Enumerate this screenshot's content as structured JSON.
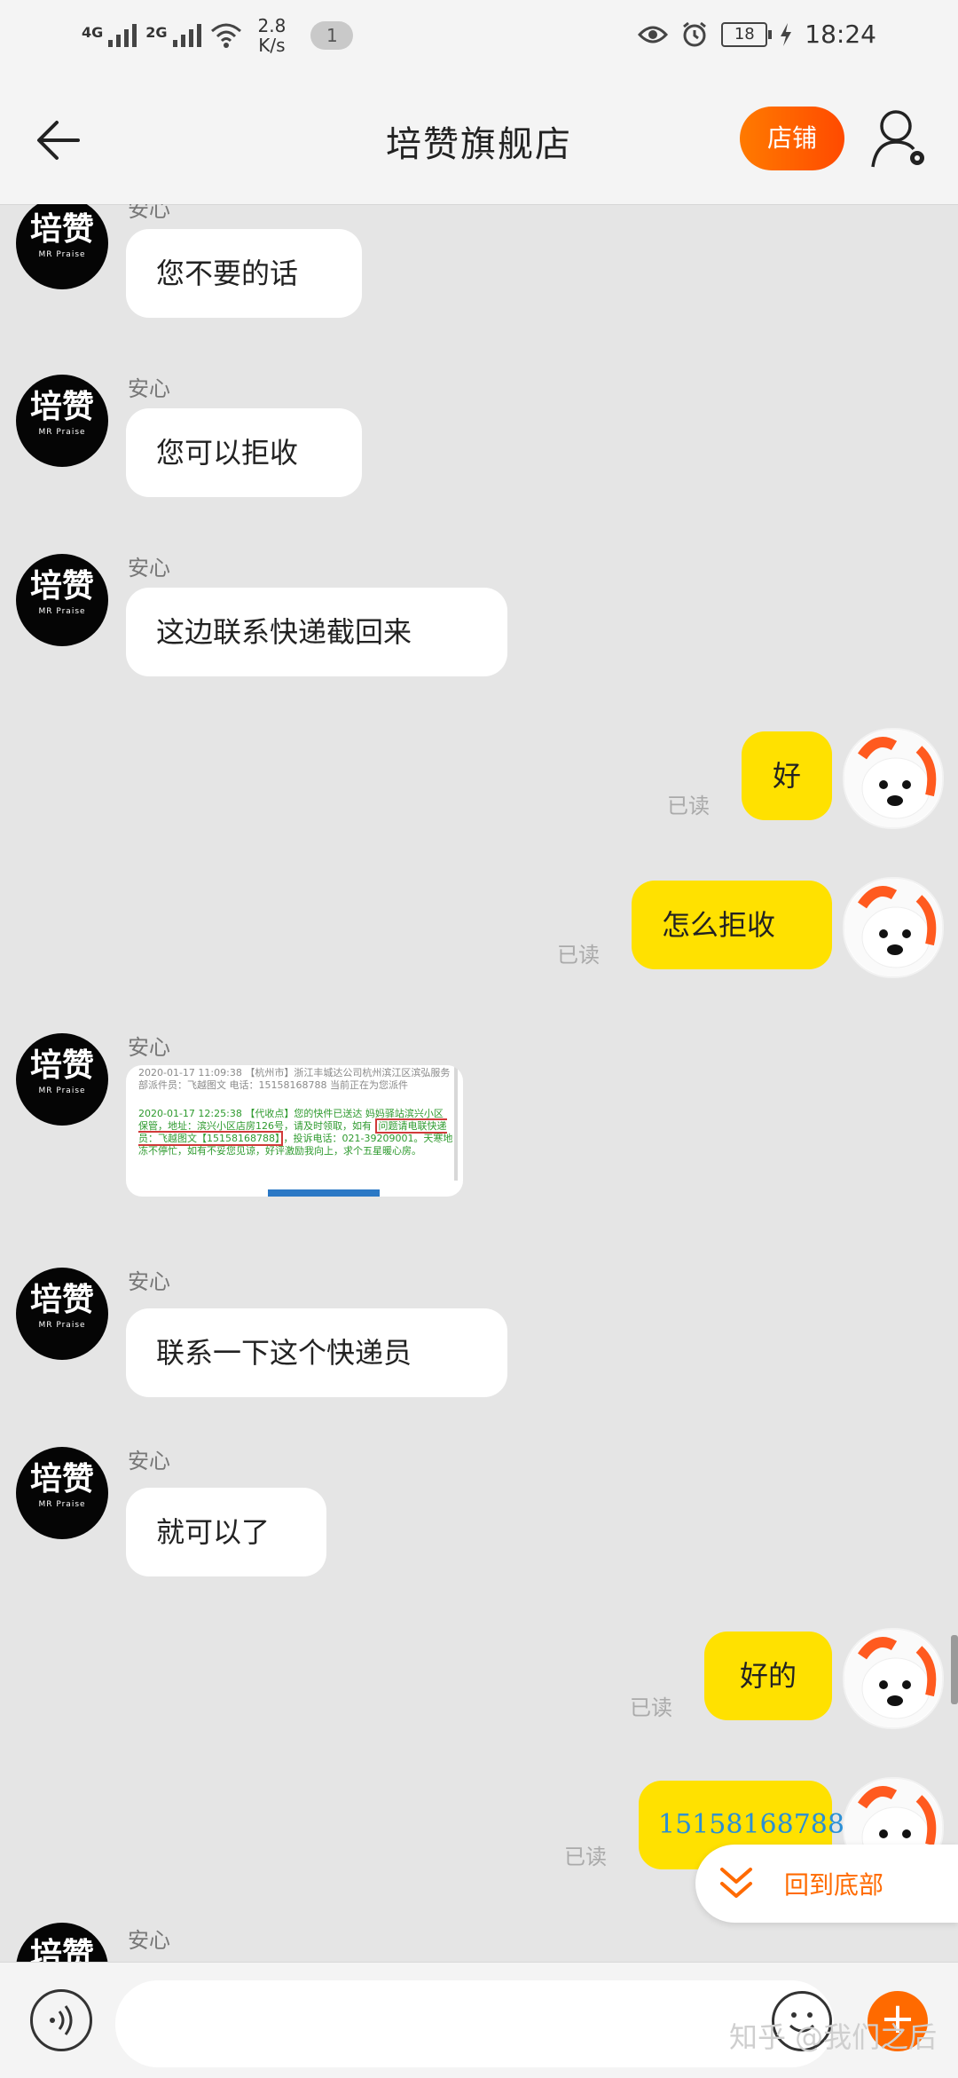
{
  "status_bar": {
    "net1": "4G",
    "net2": "2G",
    "speed_value": "2.8",
    "speed_unit": "K/s",
    "pill": "1",
    "battery": "18",
    "time": "18:24"
  },
  "header": {
    "title": "培赞旗舰店",
    "shop_button": "店铺"
  },
  "shop_avatar": {
    "main_text": "培赞",
    "sub_text": "MR Praise"
  },
  "messages": [
    {
      "sender": "安心",
      "text": "您不要的话"
    },
    {
      "sender": "安心",
      "text": "您可以拒收"
    },
    {
      "sender": "安心",
      "text": "这边联系快递截回来"
    },
    {
      "read_label": "已读",
      "text": "好"
    },
    {
      "read_label": "已读",
      "text": "怎么拒收"
    },
    {
      "sender": "安心",
      "image_lines": {
        "line1": "2020-01-17 11:09:38 【杭州市】浙江丰城达公司杭州滨江区滨弘服务部派件员：飞越图文 电话：15158168788 当前正在为您派件",
        "line2a": "2020-01-17 12:25:38 【代收点】您的快件已送达 妈妈驿站滨兴小区 保管，地址：滨兴小区店房126号，请及时领取，如有",
        "line2_highlight": "问题请电联快递员：飞越图文【15158168788】",
        "line2b": "，投诉电话：021-39209001。天寒地冻不停忙，如有不妥您见谅，好评激励我向上，求个五星暖心房。"
      }
    },
    {
      "sender": "安心",
      "text": "联系一下这个快递员"
    },
    {
      "sender": "安心",
      "text": "就可以了"
    },
    {
      "read_label": "已读",
      "text": "好的"
    },
    {
      "read_label": "已读",
      "text": "15158168788"
    },
    {
      "sender": "安心",
      "text": ""
    }
  ],
  "back_to_bottom": "回到底部",
  "watermark": "知乎 @我们之后",
  "input_bar": {
    "plus": "+"
  },
  "colors": {
    "accent": "#ff6a00",
    "own_bubble": "#ffe100",
    "chat_bg": "#e5e5e5"
  }
}
